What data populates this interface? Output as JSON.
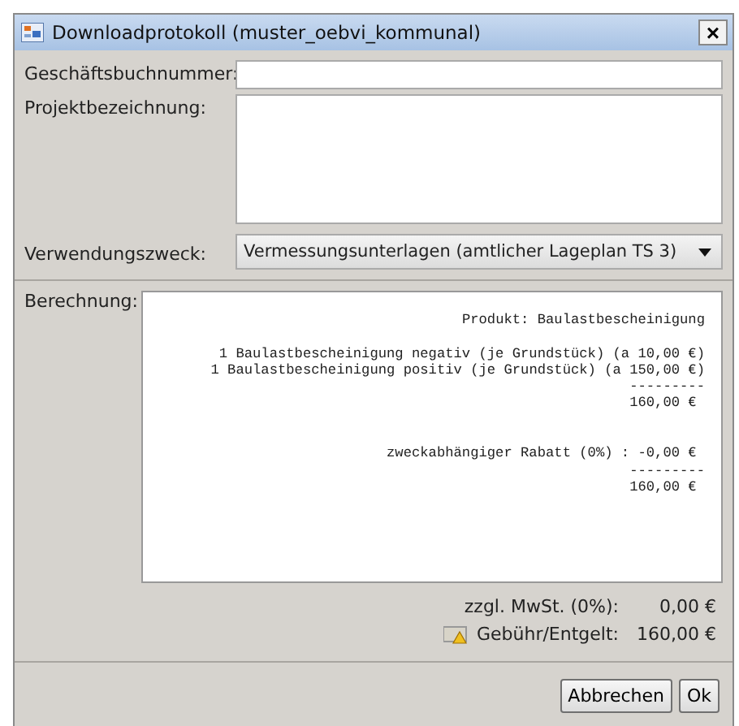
{
  "window": {
    "title": "Downloadprotokoll (muster_oebvi_kommunal)",
    "close": "×"
  },
  "form": {
    "business_number": {
      "label": "Geschäftsbuchnummer:"
    },
    "project": {
      "label": "Projektbezeichnung:"
    },
    "purpose": {
      "label": "Verwendungszweck:",
      "value": "Vermessungsunterlagen (amtlicher Lageplan TS 3)"
    }
  },
  "calculation": {
    "label": "Berechnung:",
    "lines": [
      {
        "kind": "text",
        "text": "Produkt: Baulastbescheinigung"
      },
      {
        "kind": "blank"
      },
      {
        "kind": "text",
        "text": "1 Baulastbescheinigung negativ (je Grundstück) (a 10,00 €)"
      },
      {
        "kind": "text",
        "text": "1 Baulastbescheinigung positiv (je Grundstück) (a 150,00 €)"
      },
      {
        "kind": "text",
        "text": "---------"
      },
      {
        "kind": "text",
        "text": "160,00 € "
      },
      {
        "kind": "blank"
      },
      {
        "kind": "blank"
      },
      {
        "kind": "text",
        "text": "zweckabhängiger Rabatt (0%) : -0,00 € "
      },
      {
        "kind": "text",
        "text": "---------"
      },
      {
        "kind": "text",
        "text": "160,00 € "
      }
    ]
  },
  "totals": [
    {
      "label": "zzgl. MwSt. (0%):",
      "value": "0,00 €",
      "icon": false
    },
    {
      "label": "Gebühr/Entgelt:",
      "value": "160,00 €",
      "icon": true
    }
  ],
  "buttons": [
    "Abbrechen",
    "Ok"
  ]
}
